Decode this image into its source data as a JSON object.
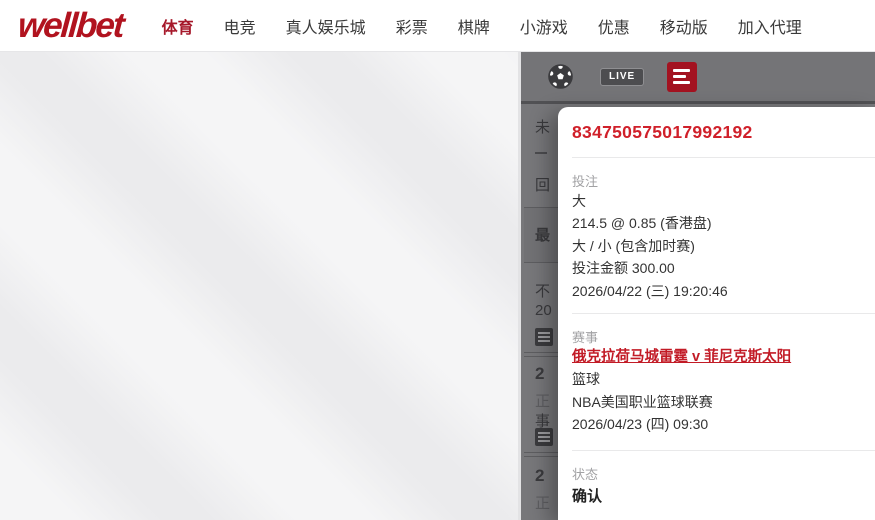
{
  "header": {
    "logo": "wellbet",
    "nav": [
      {
        "label": "体育",
        "active": true
      },
      {
        "label": "电竞"
      },
      {
        "label": "真人娱乐城"
      },
      {
        "label": "彩票"
      },
      {
        "label": "棋牌"
      },
      {
        "label": "小游戏"
      },
      {
        "label": "优惠"
      },
      {
        "label": "移动版"
      },
      {
        "label": "加入代理"
      }
    ]
  },
  "toolbar": {
    "live_badge": "LIVE"
  },
  "bet_detail": {
    "bet_id": "834750575017992192",
    "bet_section": {
      "label": "投注",
      "selection": "大",
      "line": "214.5 @ 0.85 (香港盘)",
      "market": "大 / 小 (包含加时赛)",
      "stake": "投注金额 300.00",
      "placed_at": "2026/04/22 (三) 19:20:46"
    },
    "event_section": {
      "label": "赛事",
      "match": "俄克拉荷马城雷霆 v 菲尼克斯太阳",
      "sport": "篮球",
      "league": "NBA美国职业篮球联赛",
      "start_time": "2026/04/23 (四) 09:30"
    },
    "status_section": {
      "label": "状态",
      "value": "确认"
    }
  },
  "background_fragments": [
    "未",
    "回",
    "最",
    "不",
    "20",
    "2",
    "正",
    "事",
    "2",
    "正"
  ],
  "colors": {
    "brand_red": "#b1131f",
    "accent_red": "#c21b26",
    "bet_id_red": "#d0202a",
    "panel_gray": "#77777a"
  }
}
